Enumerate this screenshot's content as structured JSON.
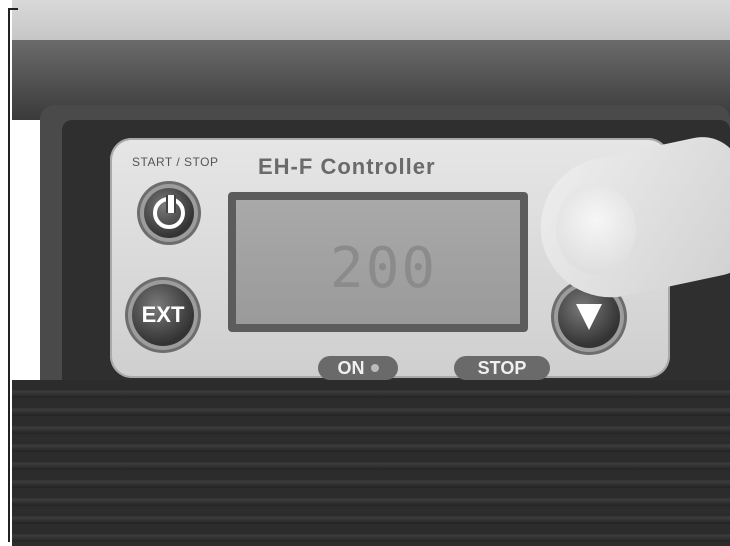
{
  "photo": {
    "subject": "device",
    "faceplate": {
      "title": "EH-F Controller",
      "start_stop_label": "START / STOP",
      "display_value": "200",
      "ext_button_label": "EXT",
      "on_indicator_label": "ON",
      "stop_indicator_label": "STOP"
    },
    "icons": {
      "power": "power-icon",
      "down": "down-arrow-icon"
    },
    "colors": {
      "faceplate": "#d9d9d9",
      "housing": "#3a3a3a",
      "lcd": "#a0a0a0"
    }
  }
}
